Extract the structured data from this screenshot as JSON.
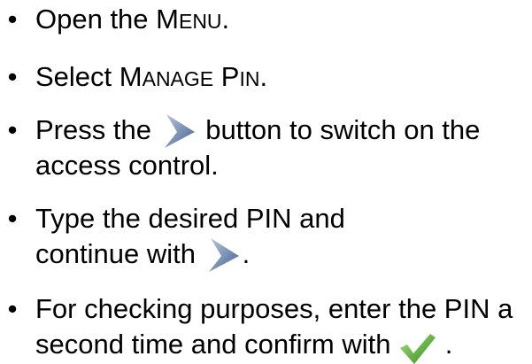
{
  "bullet_glyph": "•",
  "instructions": [
    {
      "before": "Open the ",
      "menu_first": "M",
      "menu_rest": "ENU",
      "after": "."
    },
    {
      "before": "Select ",
      "manage_first": "M",
      "manage_rest": "ANAGE",
      "space": " ",
      "pin_first": "P",
      "pin_rest": "IN",
      "after": "."
    },
    {
      "line1_before": "Press the",
      "line1_after": "button to switch on the",
      "line2": "access control."
    },
    {
      "line1": "Type the desired PIN and",
      "line2_before": "continue with",
      "line2_after": "."
    },
    {
      "line1": "For checking purposes, enter the PIN a",
      "line2_before": "second time and confirm with",
      "line2_after": "."
    }
  ],
  "icons": {
    "arrow": "chevron-right-icon",
    "check": "checkmark-icon"
  },
  "colors": {
    "arrow_light": "#b8c7dd",
    "arrow_dark": "#46618e",
    "check_light": "#a8e07c",
    "check_dark": "#2f8c1c"
  }
}
